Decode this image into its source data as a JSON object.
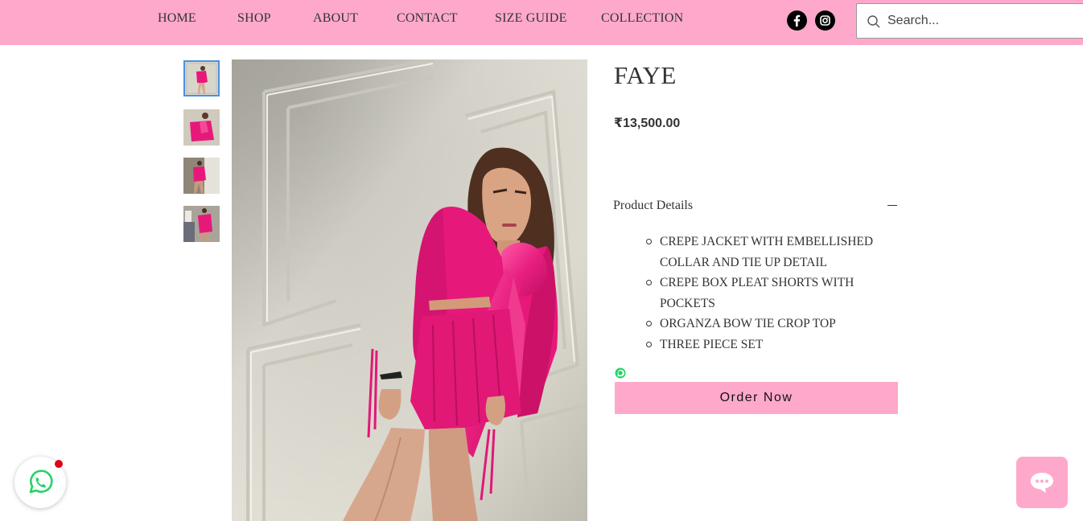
{
  "nav": {
    "items": [
      {
        "label": "HOME"
      },
      {
        "label": "SHOP"
      },
      {
        "label": "ABOUT"
      },
      {
        "label": "CONTACT"
      },
      {
        "label": "SIZE GUIDE"
      },
      {
        "label": "COLLECTION"
      }
    ]
  },
  "social": {
    "icons": [
      "facebook-icon",
      "instagram-icon"
    ]
  },
  "search": {
    "placeholder": "Search...",
    "value": ""
  },
  "gallery": {
    "thumbnail_count": 4,
    "active_index": 0
  },
  "product": {
    "title": "FAYE",
    "price": "₹13,500.00",
    "details_title": "Product Details",
    "details": [
      "CREPE JACKET WITH EMBELLISHED COLLAR AND TIE UP DETAIL",
      "CREPE BOX PLEAT SHORTS WITH POCKETS",
      "ORGANZA BOW TIE CROP TOP",
      "THREE PIECE SET"
    ],
    "order_label": "Order Now"
  },
  "colors": {
    "header_bg": "#fea9cc",
    "button_bg": "#fea9cc",
    "outfit_pink": "#e6197a",
    "whatsapp_green": "#25d366",
    "notification_red": "#e0001a"
  }
}
